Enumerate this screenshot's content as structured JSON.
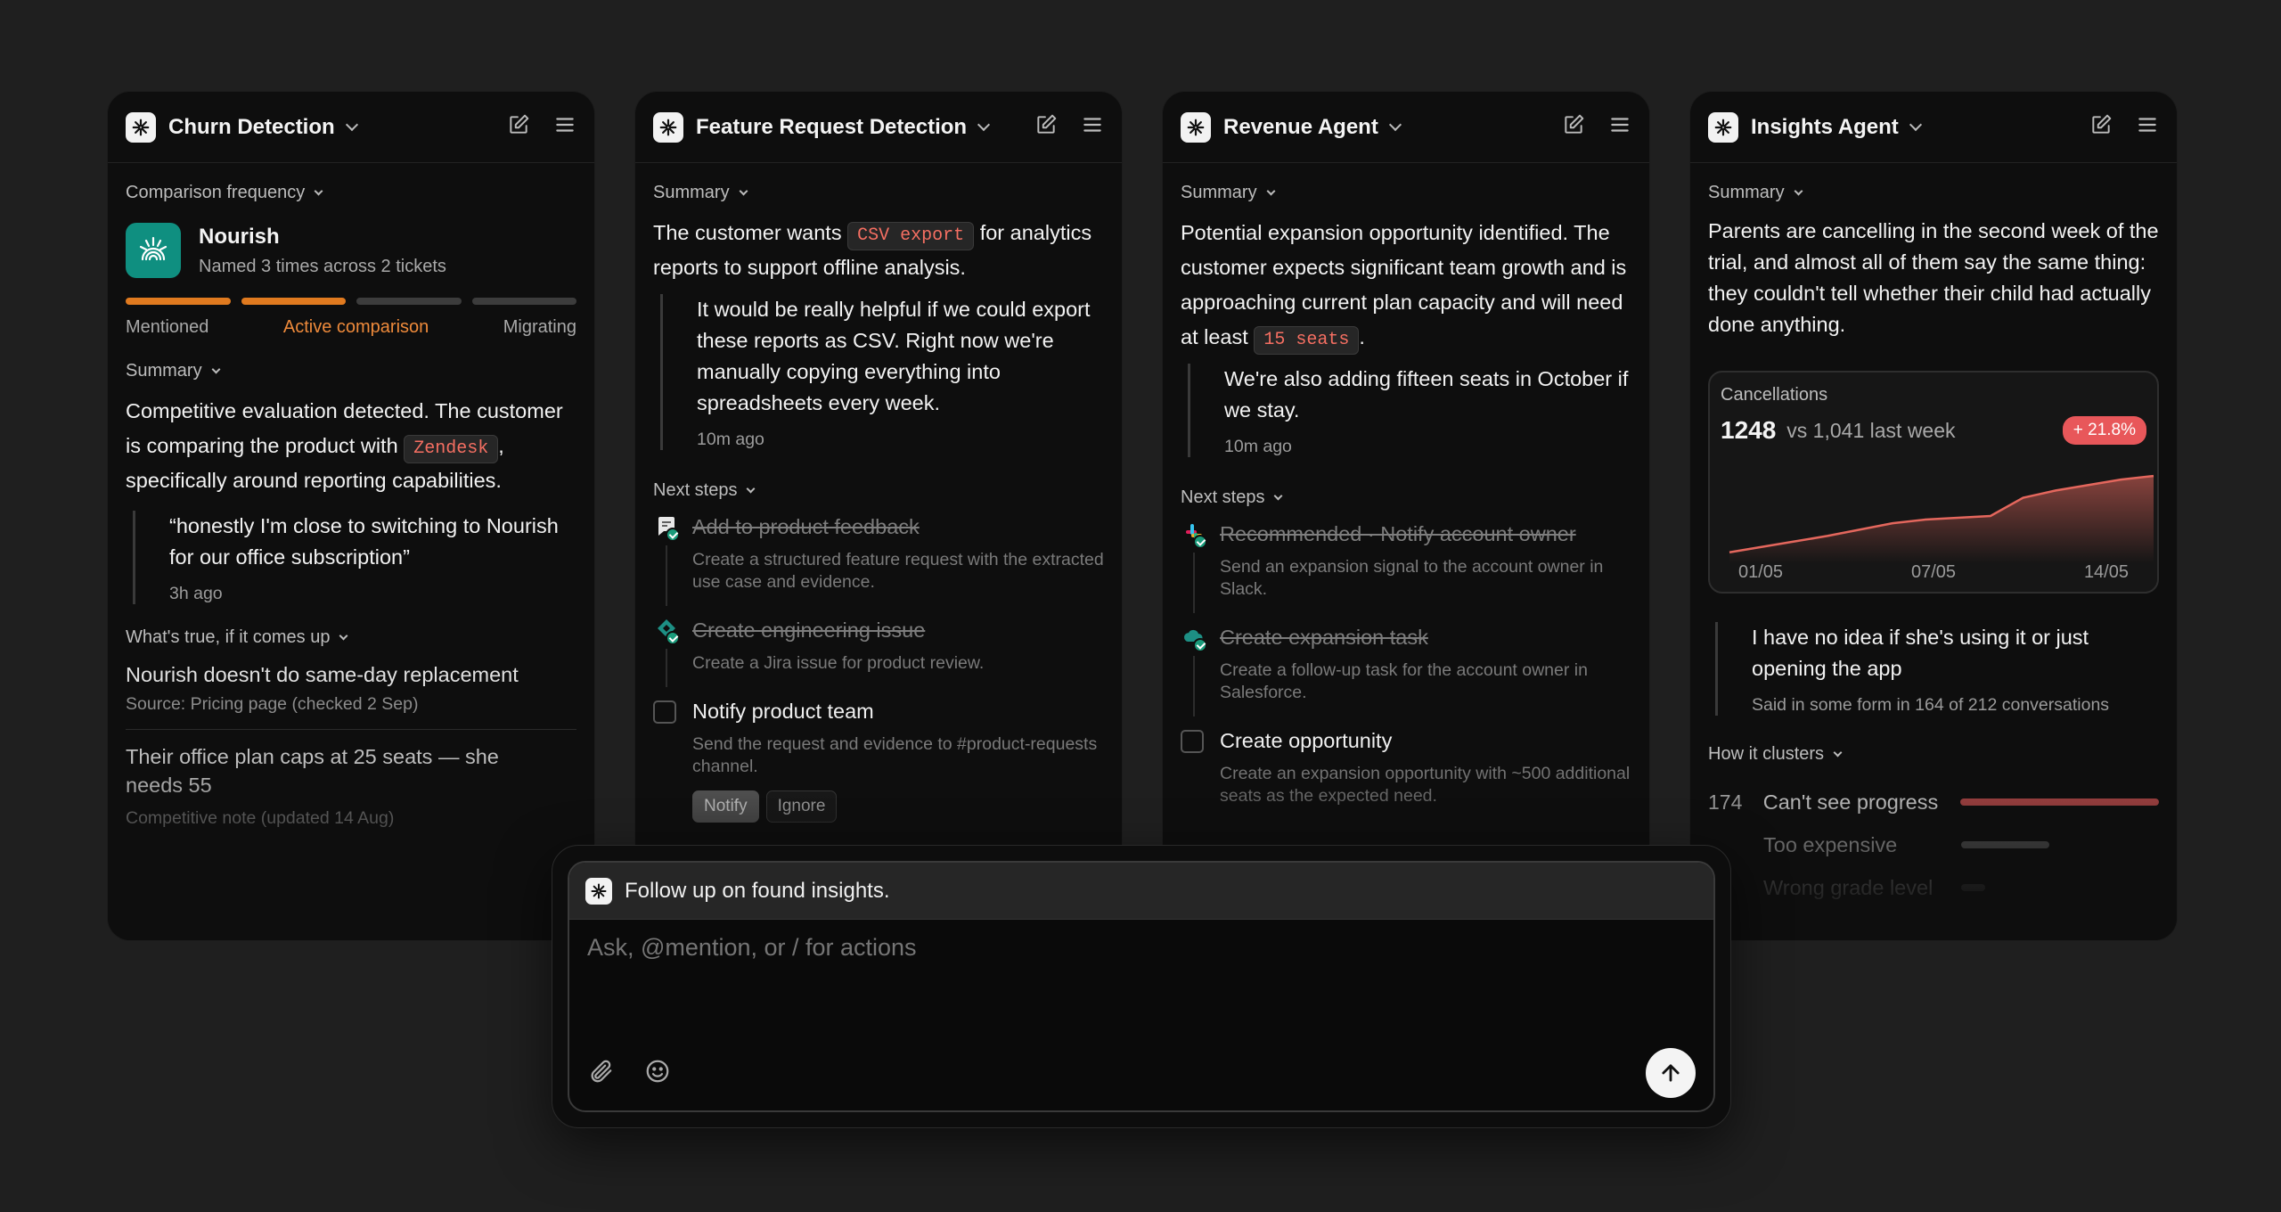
{
  "cards": [
    {
      "title": "Churn Detection",
      "frequency_label": "Comparison frequency",
      "company": {
        "name": "Nourish",
        "meta": "Named 3 times across 2 tickets"
      },
      "progress": {
        "stages": [
          "Mentioned",
          "Active comparison",
          "Migrating"
        ],
        "active_index": 1,
        "filled_segments": 2,
        "total_segments": 4
      },
      "summary_label": "Summary",
      "summary_before": "Competitive evaluation detected. The customer is comparing the product with",
      "summary_pill": "Zendesk",
      "summary_after": ", specifically around reporting capabilities.",
      "quote": "“honestly I'm close to switching to Nourish for our office subscription”",
      "quote_time": "3h ago",
      "facts_label": "What's true, if it comes up",
      "facts": [
        {
          "text": "Nourish doesn't do same-day replacement",
          "source": "Source: Pricing page (checked 2 Sep)"
        },
        {
          "text": "Their office plan caps at 25 seats — she needs 55",
          "source": "Competitive note (updated 14 Aug)"
        }
      ]
    },
    {
      "title": "Feature Request Detection",
      "summary_label": "Summary",
      "summary_before": "The customer wants",
      "summary_pill": "CSV export",
      "summary_after": "for analytics reports to support offline analysis.",
      "quote": "It would be really helpful if we could export these reports as CSV. Right now we're manually copying everything into spreadsheets every week.",
      "quote_time": "10m ago",
      "next_steps_label": "Next steps",
      "steps": [
        {
          "title": "Add to product feedback",
          "desc": "Create a structured feature request with the extracted use case and evidence.",
          "done": true,
          "icon": "feedback-icon"
        },
        {
          "title": "Create engineering issue",
          "desc": "Create a Jira issue for product review.",
          "done": true,
          "icon": "jira-icon"
        },
        {
          "title": "Notify product team",
          "desc": "Send the request and evidence to #product-requests channel.",
          "done": false,
          "icon": "checkbox"
        }
      ],
      "buttons": [
        "Notify",
        "Ignore"
      ]
    },
    {
      "title": "Revenue Agent",
      "summary_label": "Summary",
      "summary_before": "Potential expansion opportunity identified. The customer expects significant team growth and is approaching current plan capacity and will need at least",
      "summary_pill": "15 seats",
      "summary_after": ".",
      "quote": "We're also adding fifteen seats in October if we stay.",
      "quote_time": "10m ago",
      "next_steps_label": "Next steps",
      "steps": [
        {
          "title": "Recommended · Notify account owner",
          "desc": "Send an expansion signal to the account owner in Slack.",
          "done": true,
          "icon": "slack-icon"
        },
        {
          "title": "Create expansion task",
          "desc": "Create a follow-up task for the account owner in Salesforce.",
          "done": true,
          "icon": "salesforce-icon"
        },
        {
          "title": "Create opportunity",
          "desc": "Create an expansion opportunity with ~500 additional seats as the expected need.",
          "done": false,
          "icon": "checkbox"
        }
      ]
    },
    {
      "title": "Insights Agent",
      "summary_label": "Summary",
      "summary": "Parents are cancelling in the second week of the trial, and almost all of them say the same thing: they couldn't tell whether their child had actually done anything.",
      "metric": {
        "label": "Cancellations",
        "value": "1248",
        "compare": "vs 1,041 last week",
        "delta": "+ 21.8%"
      },
      "quote": "I have no idea if she's using it or just opening the app",
      "quote_meta": "Said in some form in 164 of 212 conversations",
      "clusters_label": "How it clusters",
      "clusters": [
        {
          "count": "174",
          "label": "Can't see progress",
          "share": 1.0
        },
        {
          "count": "",
          "label": "Too expensive",
          "share": 0.44
        },
        {
          "count": "",
          "label": "Wrong grade level",
          "share": 0.12
        }
      ]
    }
  ],
  "chart_data": {
    "type": "area",
    "title": "Cancellations",
    "x": [
      "01/05",
      "02/05",
      "03/05",
      "04/05",
      "05/05",
      "06/05",
      "07/05",
      "08/05",
      "09/05",
      "10/05",
      "11/05",
      "12/05",
      "13/05",
      "14/05"
    ],
    "x_ticks": [
      "01/05",
      "07/05",
      "14/05"
    ],
    "values": [
      0.12,
      0.18,
      0.24,
      0.3,
      0.37,
      0.44,
      0.48,
      0.5,
      0.52,
      0.72,
      0.8,
      0.86,
      0.92,
      0.96
    ],
    "grid": false,
    "color": "#e4675d"
  },
  "composer": {
    "context": "Follow up on found insights.",
    "placeholder": "Ask, @mention, or / for actions"
  },
  "colors": {
    "accent_orange": "#e07a1f",
    "brand_teal": "#0f8f80",
    "danger": "#f56f62"
  }
}
